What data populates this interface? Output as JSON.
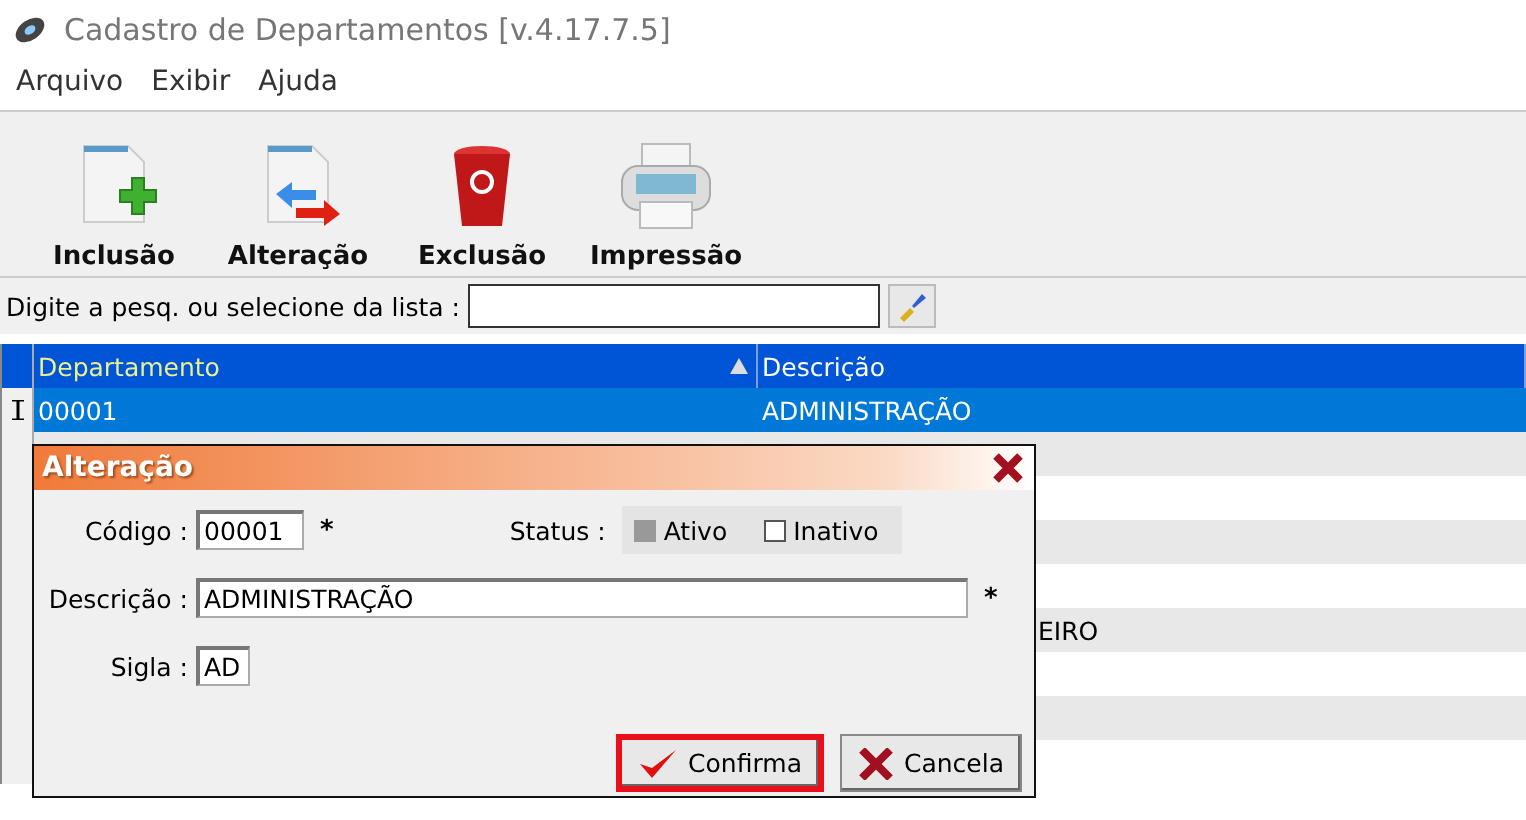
{
  "window": {
    "title": "Cadastro de Departamentos [v.4.17.7.5]"
  },
  "menu": [
    "Arquivo",
    "Exibir",
    "Ajuda"
  ],
  "toolbar": [
    {
      "kind": "add",
      "label": "Inclusão"
    },
    {
      "kind": "edit",
      "label": "Alteração"
    },
    {
      "kind": "delete",
      "label": "Exclusão"
    },
    {
      "kind": "print",
      "label": "Impressão"
    }
  ],
  "search": {
    "label": "Digite a pesq. ou selecione da lista :"
  },
  "table": {
    "columns": [
      "Departamento",
      "Descrição"
    ],
    "rows": [
      {
        "selected": true,
        "cells": [
          "00001",
          "ADMINISTRAÇÃO"
        ]
      },
      {
        "selected": false,
        "cells": []
      },
      {
        "selected": false,
        "cells": []
      },
      {
        "selected": false,
        "cells": []
      },
      {
        "selected": false,
        "cells": []
      },
      {
        "selected": false,
        "cells": [
          null,
          "EIRO"
        ]
      },
      {
        "selected": false,
        "cells": []
      },
      {
        "selected": false,
        "cells": []
      },
      {
        "selected": false,
        "cells": []
      }
    ]
  },
  "dialog": {
    "title": "Alteração",
    "code_label": "Código :",
    "code": "00001",
    "required_mark": "*",
    "status_label": "Status :",
    "status": [
      {
        "label": "Ativo",
        "checked": true
      },
      {
        "label": "Inativo",
        "checked": false
      }
    ],
    "description_label": "Descrição :",
    "description": "ADMINISTRAÇÃO",
    "description_required": "*",
    "acronym_label": "Sigla :",
    "acronym": "AD",
    "buttons": [
      {
        "kind": "confirm",
        "label": "Confirma",
        "highlighted": true
      },
      {
        "kind": "cancel",
        "label": "Cancela",
        "highlighted": false
      }
    ]
  }
}
